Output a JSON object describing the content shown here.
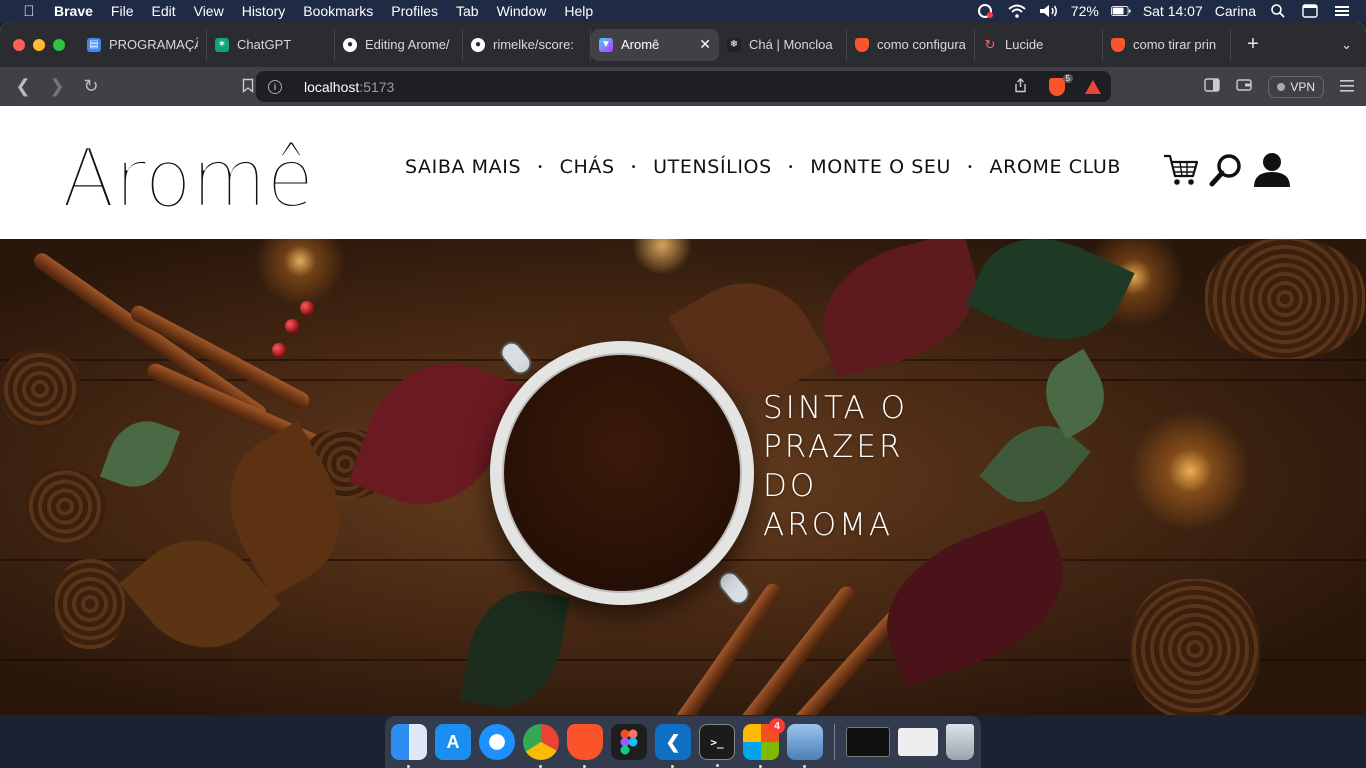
{
  "menubar": {
    "app_name": "Brave",
    "menus": [
      "File",
      "Edit",
      "View",
      "History",
      "Bookmarks",
      "Profiles",
      "Tab",
      "Window",
      "Help"
    ],
    "battery": "72%",
    "clock": "Sat 14:07",
    "user": "Carina"
  },
  "tabs": [
    {
      "title": "PROGRAMAÇÃ",
      "favicon": "google-docs-icon",
      "color": "#4285f4"
    },
    {
      "title": "ChatGPT",
      "favicon": "chatgpt-icon",
      "color": "#10a37f"
    },
    {
      "title": "Editing Arome/",
      "favicon": "github-icon",
      "color": "#24292f"
    },
    {
      "title": "rimelke/score:",
      "favicon": "github-icon",
      "color": "#24292f"
    },
    {
      "title": "Aromê",
      "favicon": "vite-icon",
      "color": "#9f6bff",
      "active": true
    },
    {
      "title": "Chá | Moncloa",
      "favicon": "site-icon",
      "color": "#222222"
    },
    {
      "title": "como configura",
      "favicon": "brave-search-icon",
      "color": "#fb542b"
    },
    {
      "title": "Lucide",
      "favicon": "lucide-icon",
      "color": "#f56565"
    },
    {
      "title": "como tirar prin",
      "favicon": "brave-search-icon",
      "color": "#fb542b"
    }
  ],
  "address": {
    "host": "localhost",
    "port": ":5173"
  },
  "toolbar": {
    "shield_count": "5",
    "vpn_label": "VPN"
  },
  "site": {
    "logo_text": "Aromê",
    "nav": [
      "SAIBA MAIS",
      "CHÁS",
      "UTENSÍLIOS",
      "MONTE O SEU",
      "AROME CLUB"
    ],
    "nav_separator": "•",
    "hero_lines": [
      "SINTA O",
      "PRAZER",
      "DO",
      "AROMA"
    ]
  },
  "dock": {
    "apps": [
      {
        "name": "finder",
        "color": "#2f8cf0"
      },
      {
        "name": "app-store",
        "color": "#1a8ff0"
      },
      {
        "name": "safari",
        "color": "#1e90ff"
      },
      {
        "name": "chrome",
        "color": "#e8e8e8"
      },
      {
        "name": "brave",
        "color": "#fb542b"
      },
      {
        "name": "figma",
        "color": "#1e1e1e"
      },
      {
        "name": "vscode",
        "color": "#0f6fc4"
      },
      {
        "name": "terminal",
        "color": "#1b1b1b"
      },
      {
        "name": "microsoft-office",
        "color": "#f0f0f0",
        "badge": "4"
      },
      {
        "name": "preview",
        "color": "#7aa7d8"
      }
    ],
    "recent": [
      {
        "name": "terminal-window"
      },
      {
        "name": "screenshot-window"
      },
      {
        "name": "trash"
      }
    ]
  }
}
